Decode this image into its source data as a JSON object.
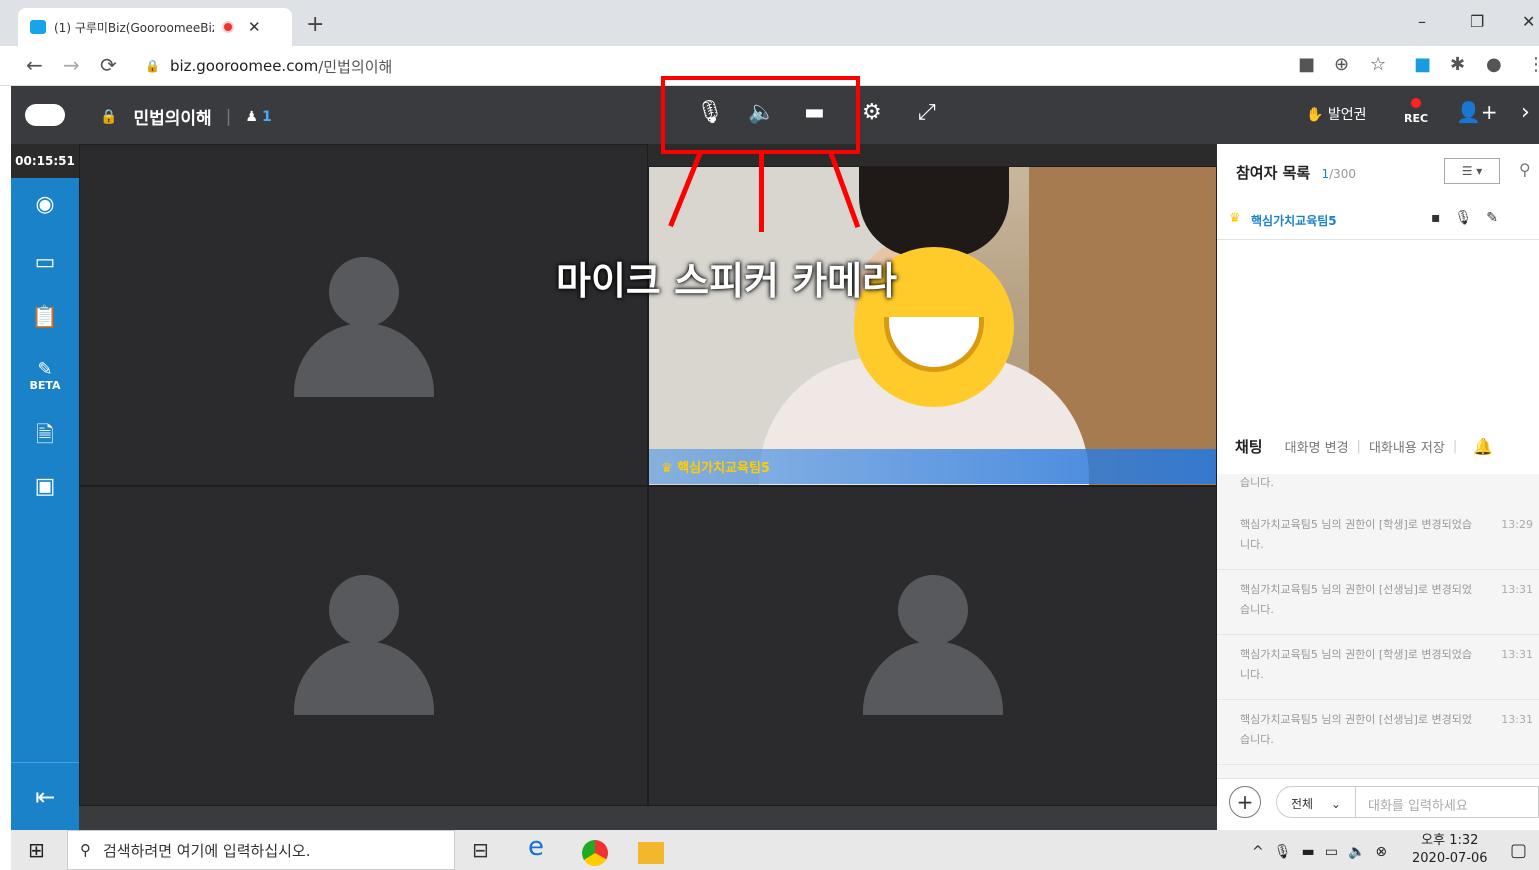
{
  "browser": {
    "tab_title": "(1) 구루미Biz(GooroomeeBiz",
    "tab_close": "✕",
    "new_tab": "+",
    "url_domain": "biz.gooroomee.com",
    "url_path": "/민법의이해",
    "min": "–",
    "restore": "❐",
    "close": "✕"
  },
  "app": {
    "room_title": "민법의이해",
    "participant_count": "1",
    "timer": "00:15:51",
    "speaker_rights": "발언권",
    "rec": "REC",
    "beta": "BETA",
    "video_name": "핵심가치교육팀5"
  },
  "annotation": {
    "label": "마이크 스피커 카메라"
  },
  "participants": {
    "title": "참여자 목록",
    "count": "1",
    "max": "/300",
    "items": [
      {
        "name": "핵심가치교육팀5"
      }
    ]
  },
  "chat": {
    "title": "채팅",
    "rename": "대화명 변경",
    "save": "대화내용 저장",
    "partial": "습니다.",
    "messages": [
      {
        "text": "핵심가치교육팀5 님의 권한이 [학생]로 변경되었습니다.",
        "time": "13:29"
      },
      {
        "text": "핵심가치교육팀5 님의 권한이 [선생님]로 변경되었습니다.",
        "time": "13:31"
      },
      {
        "text": "핵심가치교육팀5 님의 권한이 [학생]로 변경되었습니다.",
        "time": "13:31"
      },
      {
        "text": "핵심가치교육팀5 님의 권한이 [선생님]로 변경되었습니다.",
        "time": "13:31"
      }
    ],
    "scope": "전체",
    "placeholder": "대화를 입력하세요"
  },
  "taskbar": {
    "search_placeholder": "검색하려면 여기에 입력하십시오.",
    "time": "오후 1:32",
    "date": "2020-07-06"
  },
  "colors": {
    "accent": "#1a82c8",
    "annotation": "#ff0000"
  }
}
